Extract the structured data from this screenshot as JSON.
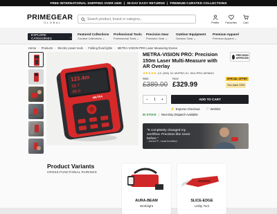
{
  "promo": {
    "items": [
      "FREE INTERNATIONAL SHIPPING OVER £500",
      "|",
      "30-DAY EASY RETURNS",
      "|",
      "PREMIUM CURATED COLLECTIONS"
    ]
  },
  "header": {
    "logo_main": "PRIMEGEAR",
    "logo_sub": "GLOBAL",
    "search_placeholder": "Search product, brand or category...",
    "icons": [
      {
        "label": "Profile",
        "icon": "user-icon"
      },
      {
        "label": "Favorites",
        "icon": "heart-icon"
      },
      {
        "label": "Cart",
        "icon": "cart-icon"
      }
    ]
  },
  "nav": {
    "explore_label": "EXPLORE CATEGORIES",
    "items": [
      {
        "title": "Featured Collections",
        "sub": "Curated Collections ⌄"
      },
      {
        "title": "Professional Tools",
        "sub": "Professional Tools ⌄"
      },
      {
        "title": "Precision Gear",
        "sub": "Precision Gear ⌄"
      },
      {
        "title": "Outdoor Equipment",
        "sub": "Outdoor Gear ⌄"
      },
      {
        "title": "Premium Apparel",
        "sub": "Premium Apparel ⌄"
      }
    ]
  },
  "breadcrumb": [
    "Home",
    "Products",
    "Electric power tools",
    "Folding flood lights",
    "METRA-VISION PRO Laser Measuring Device"
  ],
  "product": {
    "title": "METRA-VISION PRO: Precision 150m Laser Multi-Measure with AR Overlay",
    "badge": "PRECISION APPROVED",
    "rating": "4.9",
    "reviews": "(300)",
    "id": "ID: MVPRO-X1",
    "sku": "SKU-PRO-9876543",
    "was_label": "Was:",
    "was_price": "£389.00",
    "now_label": "Now:",
    "now_price": "£329.99",
    "special_offer": "SPECIAL OFFER",
    "you_save": "You save 15%",
    "qty": "1",
    "add_to_cart": "ADD TO CART",
    "express_checkout": "Express Checkout",
    "wishlist": "Wishlist",
    "stock": "IN STOCK",
    "dispatch": "Next-Day Dispatch Available",
    "device_readings": [
      "123.4m",
      "56.7",
      "89.0"
    ],
    "device_brand": "METRA"
  },
  "testimonial": {
    "quote": "\"It completely changed my workflow. Precision like never before.\"",
    "author": "- James P., Lead Architect"
  },
  "variants": {
    "title": "Product Variants",
    "subtitle": "CROSS-FUNCTIONAL PAIRINGS",
    "cards": [
      {
        "name": "AURA-BEAM",
        "category": "Worklight"
      },
      {
        "name": "SLICE-EDGE",
        "category": "Utility Tool"
      }
    ]
  },
  "colors": {
    "accent_red": "#d7292a",
    "gold": "#f5c22c",
    "dark": "#1d1f24",
    "in_stock": "#2a8a3e"
  }
}
